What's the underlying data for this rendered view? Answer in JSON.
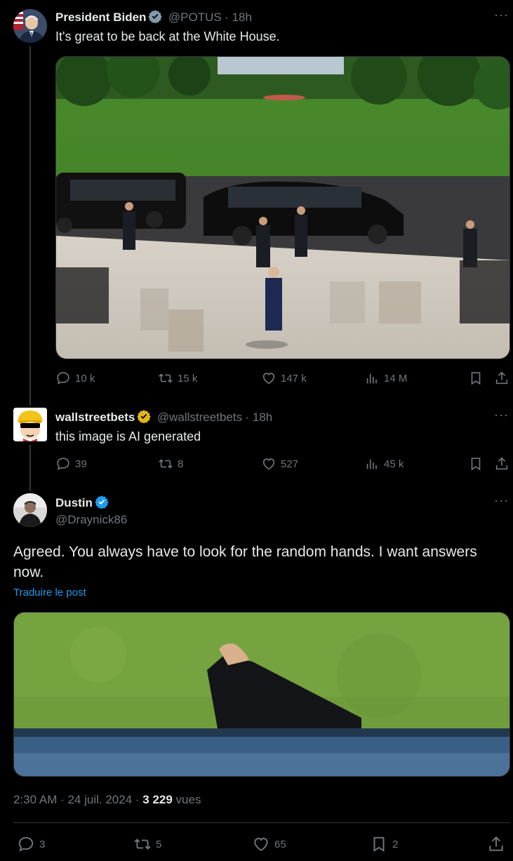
{
  "tweet1": {
    "name": "President Biden",
    "handle": "@POTUS",
    "time": "· 18h",
    "text": "It's great to be back at the White House.",
    "image_alt": "President Biden walking up the steps from a black limousine on the South Lawn",
    "badge_color": "#829aab",
    "stats": {
      "replies": "10 k",
      "retweets": "15 k",
      "likes": "147 k",
      "views": "14 M"
    }
  },
  "tweet2": {
    "name": "wallstreetbets",
    "handle": "@wallstreetbets",
    "time": "· 18h",
    "text": "this image is AI generated",
    "badge_color": "#e2b719",
    "stats": {
      "replies": "39",
      "retweets": "8",
      "likes": "527",
      "views": "45 k"
    }
  },
  "tweet3": {
    "name": "Dustin",
    "handle": "@Draynick86",
    "text": "Agreed. You always have to look for the random hands. I want answers now.",
    "translate": "Traduire le post",
    "image_alt": "Close-up crop of a hand holding the car door over the lawn",
    "badge_color": "#1d9bf0",
    "timestamp": "2:30 AM · 24 juil. 2024 · ",
    "views_count": "3 229",
    "views_label": " vues",
    "stats": {
      "replies": "3",
      "retweets": "5",
      "likes": "65",
      "bookmarks": "2"
    }
  },
  "icons": [
    "reply-icon",
    "retweet-icon",
    "like-icon",
    "views-icon",
    "bookmark-icon",
    "share-icon",
    "more-icon",
    "verified-icon"
  ]
}
